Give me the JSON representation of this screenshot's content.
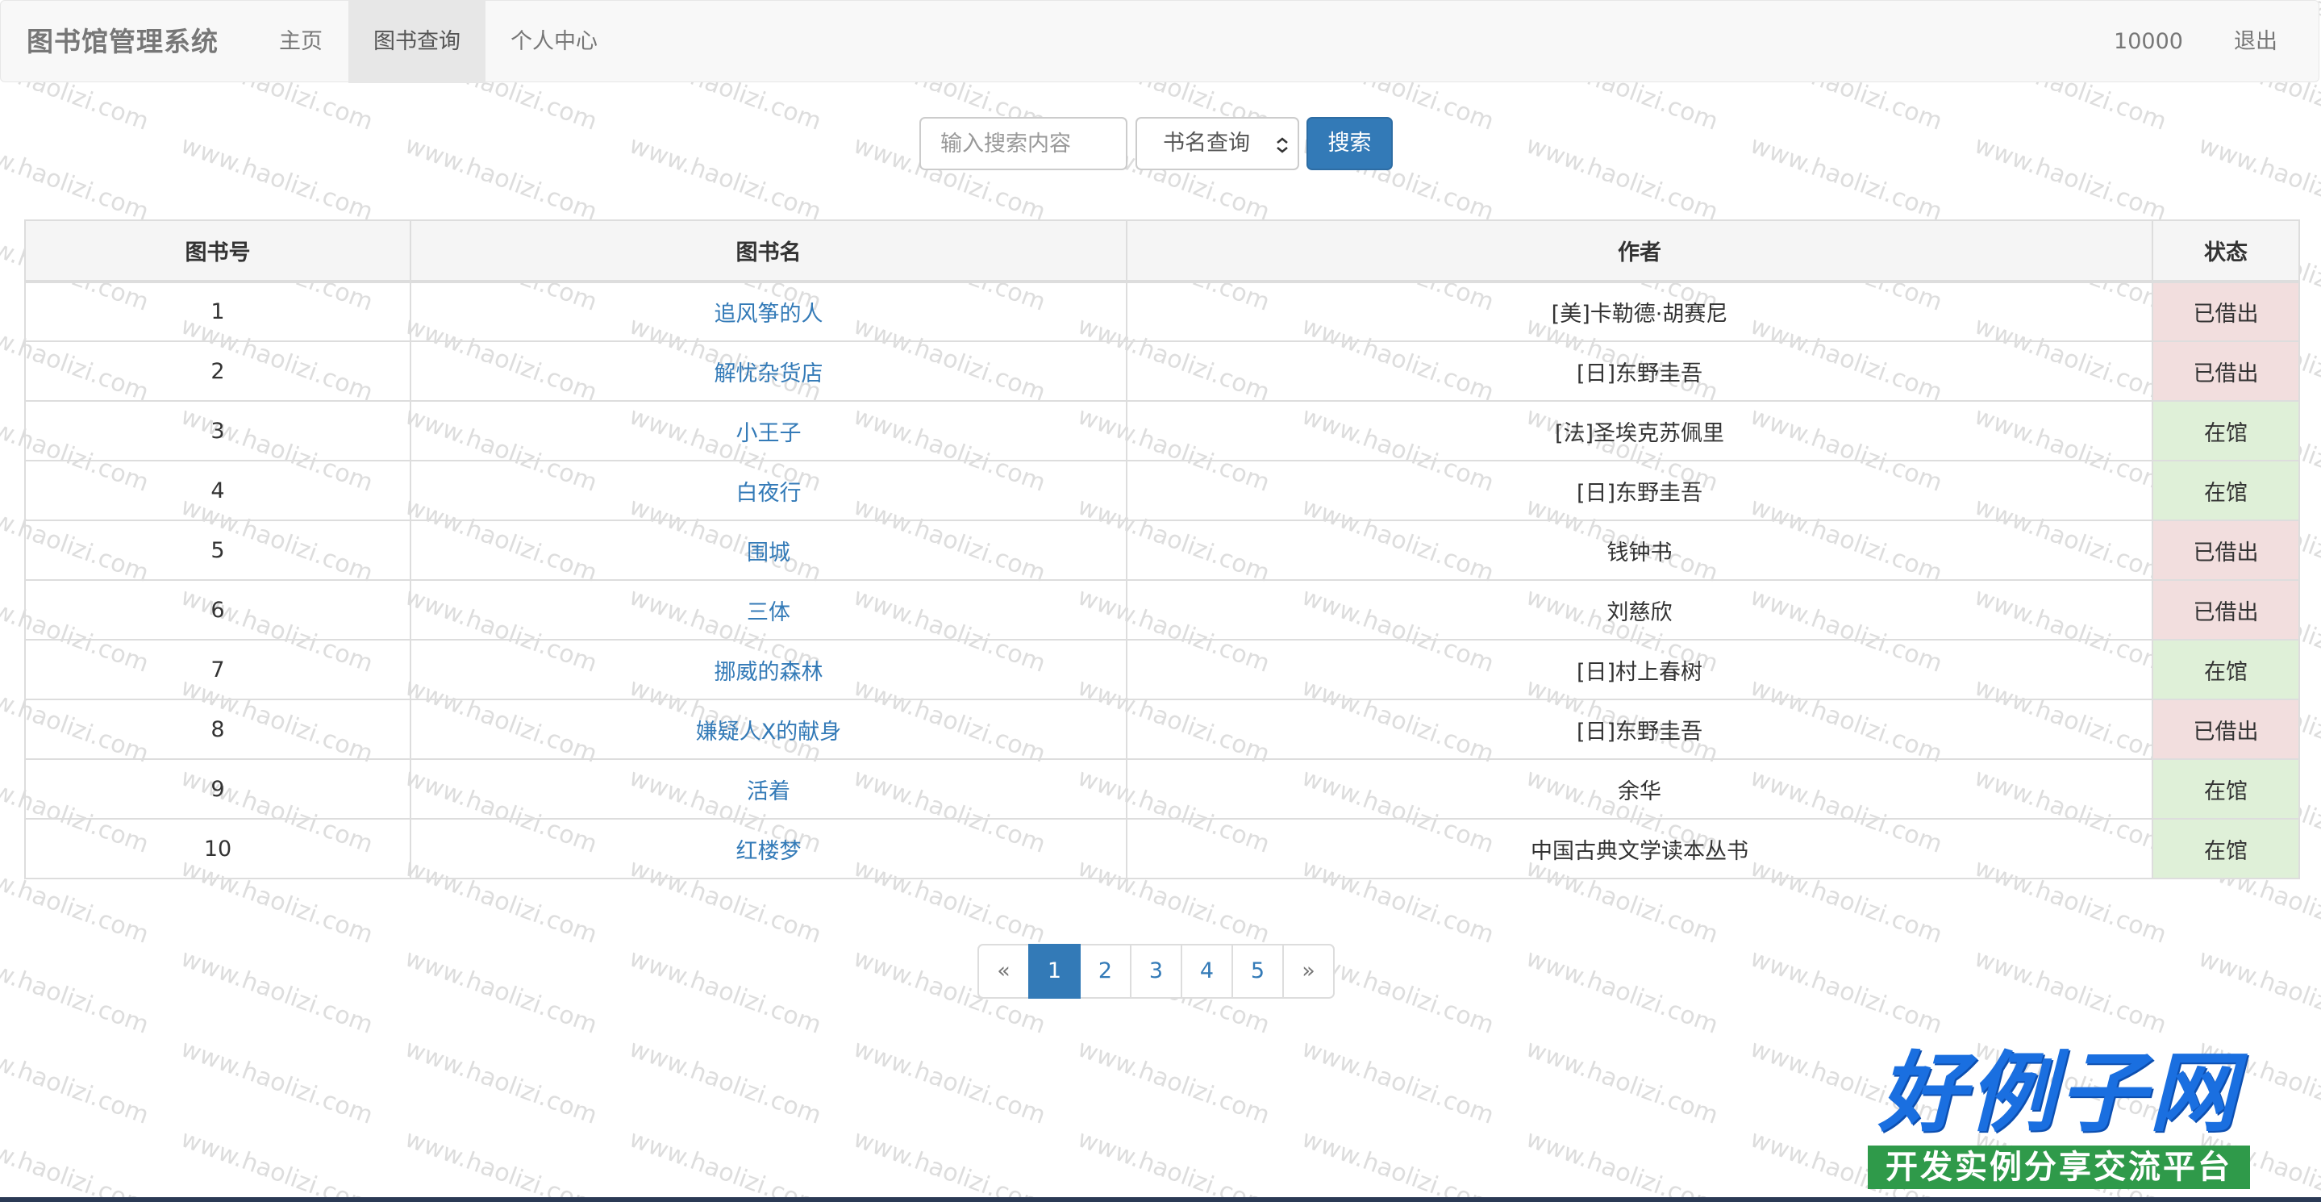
{
  "navbar": {
    "brand": "图书馆管理系统",
    "items": [
      {
        "label": "主页",
        "active": false
      },
      {
        "label": "图书查询",
        "active": true
      },
      {
        "label": "个人中心",
        "active": false
      }
    ],
    "user_id": "10000",
    "logout_label": "退出"
  },
  "search": {
    "placeholder": "输入搜索内容",
    "select_value": "书名查询",
    "button_label": "搜索"
  },
  "table": {
    "headers": [
      "图书号",
      "图书名",
      "作者",
      "状态"
    ],
    "rows": [
      {
        "id": "1",
        "name": "追风筝的人",
        "author": "[美]卡勒德·胡赛尼",
        "status": "已借出",
        "status_type": "out"
      },
      {
        "id": "2",
        "name": "解忧杂货店",
        "author": "[日]东野圭吾",
        "status": "已借出",
        "status_type": "out"
      },
      {
        "id": "3",
        "name": "小王子",
        "author": "[法]圣埃克苏佩里",
        "status": "在馆",
        "status_type": "in"
      },
      {
        "id": "4",
        "name": "白夜行",
        "author": "[日]东野圭吾",
        "status": "在馆",
        "status_type": "in"
      },
      {
        "id": "5",
        "name": "围城",
        "author": "钱钟书",
        "status": "已借出",
        "status_type": "out"
      },
      {
        "id": "6",
        "name": "三体",
        "author": "刘慈欣",
        "status": "已借出",
        "status_type": "out"
      },
      {
        "id": "7",
        "name": "挪威的森林",
        "author": "[日]村上春树",
        "status": "在馆",
        "status_type": "in"
      },
      {
        "id": "8",
        "name": "嫌疑人X的献身",
        "author": "[日]东野圭吾",
        "status": "已借出",
        "status_type": "out"
      },
      {
        "id": "9",
        "name": "活着",
        "author": "余华",
        "status": "在馆",
        "status_type": "in"
      },
      {
        "id": "10",
        "name": "红楼梦",
        "author": "中国古典文学读本丛书",
        "status": "在馆",
        "status_type": "in"
      }
    ]
  },
  "pagination": {
    "prev": "«",
    "pages": [
      "1",
      "2",
      "3",
      "4",
      "5"
    ],
    "current": "1",
    "next": "»"
  },
  "watermark": "www.haolizi.com",
  "logo": {
    "title": "好例子网",
    "subtitle": "开发实例分享交流平台"
  },
  "colors": {
    "primary": "#337ab7",
    "borrowed_bg": "#f2dede",
    "available_bg": "#dff0d8",
    "navbar_bg": "#f8f8f8"
  }
}
